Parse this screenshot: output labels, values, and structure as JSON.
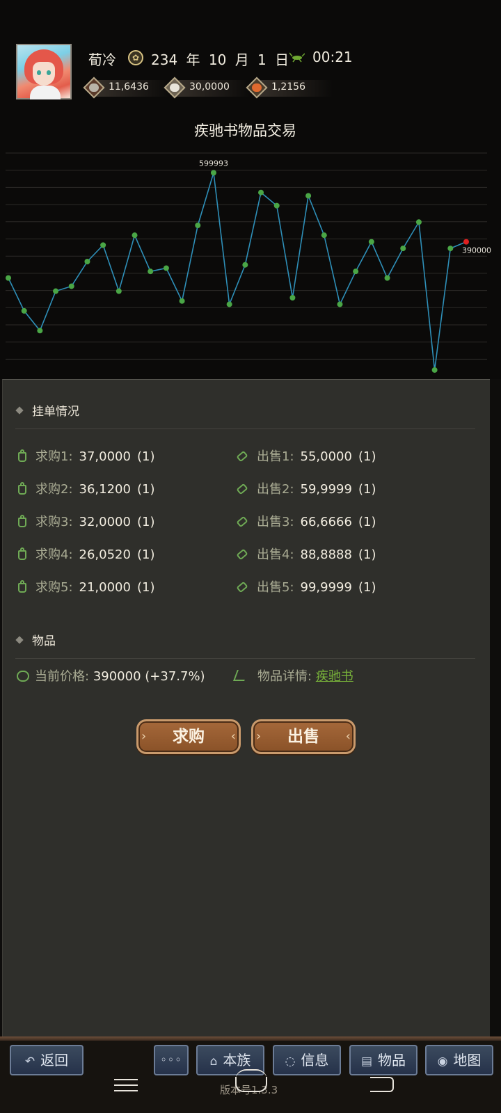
{
  "header": {
    "player_name": "荀冷",
    "date": "234 年 10 月 1 日",
    "time": "00:21",
    "resources": [
      {
        "icon": "silver-coin-icon",
        "value": "11,6436"
      },
      {
        "icon": "rice-bowl-icon",
        "value": "30,0000"
      },
      {
        "icon": "orange-token-icon",
        "value": "1,2156"
      }
    ]
  },
  "page_title": "疾驰书物品交易",
  "chart_data": {
    "type": "line",
    "title": "",
    "series": [
      {
        "values": [
          280000,
          180000,
          120000,
          240000,
          255000,
          330000,
          380000,
          240000,
          410000,
          300000,
          310000,
          210000,
          440000,
          599993,
          200000,
          320000,
          540000,
          500000,
          220000,
          530000,
          410000,
          200000,
          300000,
          390000,
          280000,
          370000,
          450000,
          178,
          370000,
          390000
        ]
      }
    ],
    "annotations": [
      {
        "label": "599993",
        "index": 13
      },
      {
        "label": "390000",
        "index": 29
      },
      {
        "label": "178",
        "index": 27
      }
    ],
    "last_point_color": "#e02020",
    "line_color": "#2e8fb8",
    "point_color": "#4aa646",
    "grid": true,
    "ylim": [
      0,
      660000
    ]
  },
  "orders": {
    "section_title": "挂单情况",
    "buy": [
      {
        "label": "求购1:",
        "price": "37,0000",
        "count": "(1)"
      },
      {
        "label": "求购2:",
        "price": "36,1200",
        "count": "(1)"
      },
      {
        "label": "求购3:",
        "price": "32,0000",
        "count": "(1)"
      },
      {
        "label": "求购4:",
        "price": "26,0520",
        "count": "(1)"
      },
      {
        "label": "求购5:",
        "price": "21,0000",
        "count": "(1)"
      }
    ],
    "sell": [
      {
        "label": "出售1:",
        "price": "55,0000",
        "count": "(1)"
      },
      {
        "label": "出售2:",
        "price": "59,9999",
        "count": "(1)"
      },
      {
        "label": "出售3:",
        "price": "66,6666",
        "count": "(1)"
      },
      {
        "label": "出售4:",
        "price": "88,8888",
        "count": "(1)"
      },
      {
        "label": "出售5:",
        "price": "99,9999",
        "count": "(1)"
      }
    ]
  },
  "item": {
    "section_title": "物品",
    "price_label": "当前价格:",
    "price_value": "390000",
    "price_change": "(+37.7%)",
    "detail_label": "物品详情:",
    "detail_link": "疾驰书"
  },
  "actions": {
    "buy": "求购",
    "sell": "出售"
  },
  "bottom_nav": {
    "back": "返回",
    "more": "◦◦◦",
    "clan": "本族",
    "messages": "信息",
    "items": "物品",
    "map": "地图",
    "version": "版本号1.3.3"
  }
}
